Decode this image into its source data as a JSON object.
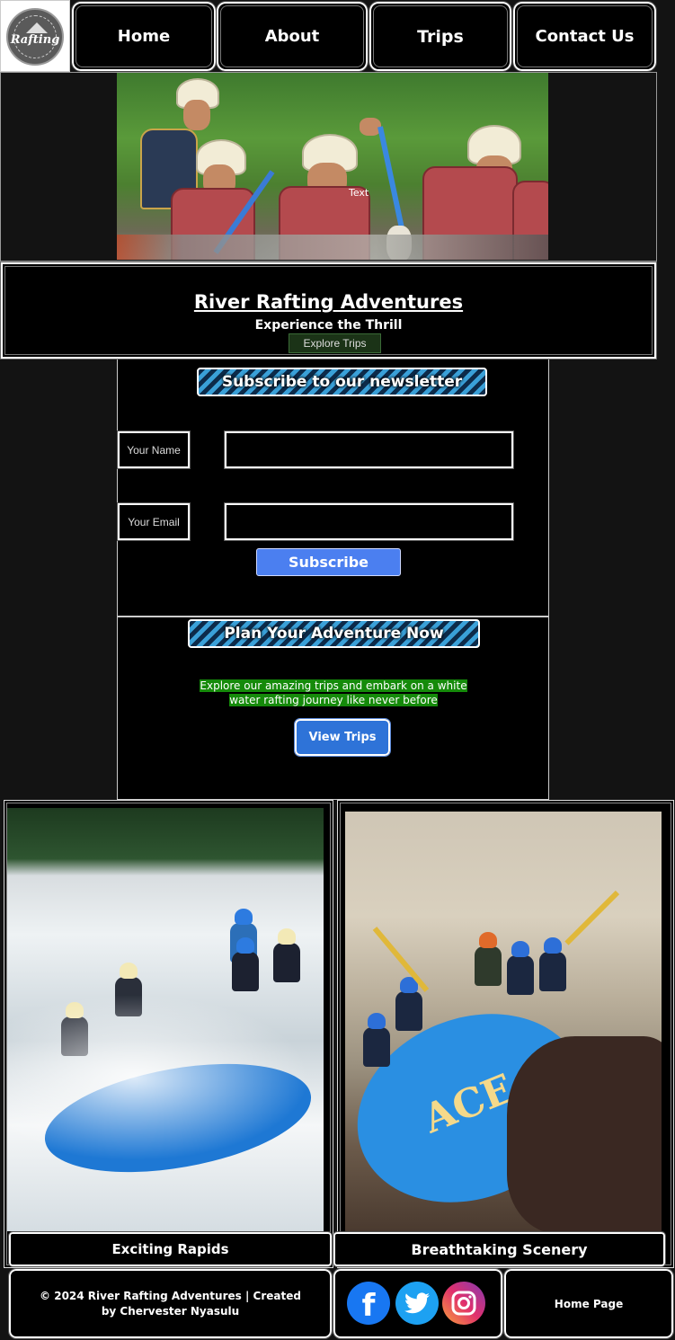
{
  "nav": {
    "logo_text": "Rafting",
    "items": [
      {
        "label": "Home"
      },
      {
        "label": "About"
      },
      {
        "label": "Trips"
      },
      {
        "label": "Contact Us"
      }
    ]
  },
  "hero": {
    "image_caption": "Text"
  },
  "banner": {
    "title": "River Rafting Adventures",
    "subtitle": "Experience the Thrill",
    "button_label": "Explore Trips"
  },
  "newsletter": {
    "heading": "Subscribe to our newsletter",
    "name_label": "Your Name",
    "name_value": "",
    "email_label": "Your Email",
    "email_value": "",
    "button_label": "Subscribe"
  },
  "plan": {
    "heading": "Plan Your Adventure Now",
    "text": "Explore our amazing trips and embark on a white water rafting journey like never before",
    "button_label": "View Trips"
  },
  "gallery": {
    "items": [
      {
        "caption": "Exciting Rapids"
      },
      {
        "caption": "Breathtaking Scenery"
      }
    ],
    "raft_text": "ACE"
  },
  "footer": {
    "copyright": "© 2024 River Rafting Adventures | Created by Chervester Nyasulu",
    "social": [
      {
        "icon": "facebook-icon",
        "color": "#1877f2"
      },
      {
        "icon": "twitter-icon",
        "color": "#1da1f2"
      },
      {
        "icon": "instagram-icon",
        "color": "#c13584"
      }
    ],
    "home_link": "Home Page"
  }
}
